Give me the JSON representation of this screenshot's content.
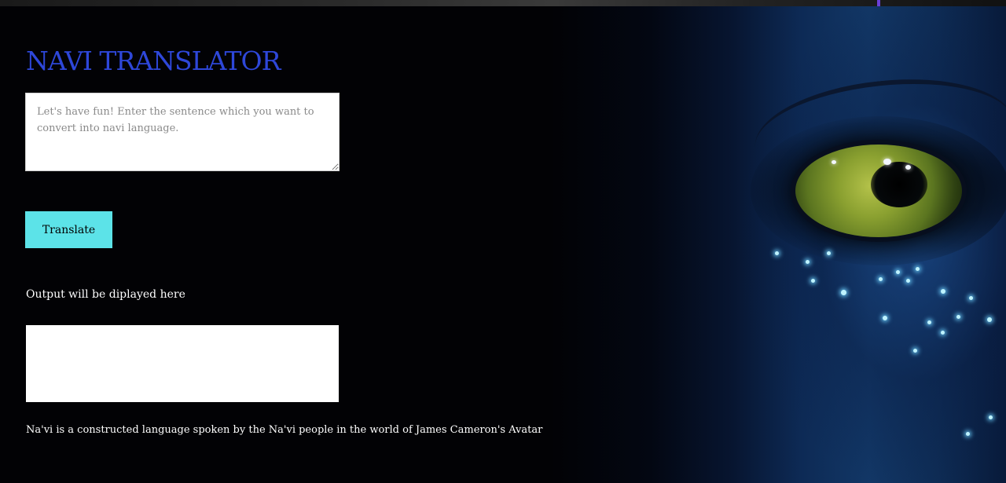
{
  "header": {
    "title": "NAVI TRANSLATOR"
  },
  "translator": {
    "input_placeholder": "Let's have fun! Enter the sentence which you want to convert into navi language.",
    "input_value": "",
    "translate_label": "Translate",
    "output_label": "Output will be diplayed here",
    "output_value": ""
  },
  "footer": {
    "note": "Na'vi is a constructed language spoken by the Na'vi people in the world of James Cameron's Avatar"
  },
  "colors": {
    "background": "#000000",
    "title": "#2e47d9",
    "button": "#5ce3e8",
    "text": "#ffffff"
  }
}
